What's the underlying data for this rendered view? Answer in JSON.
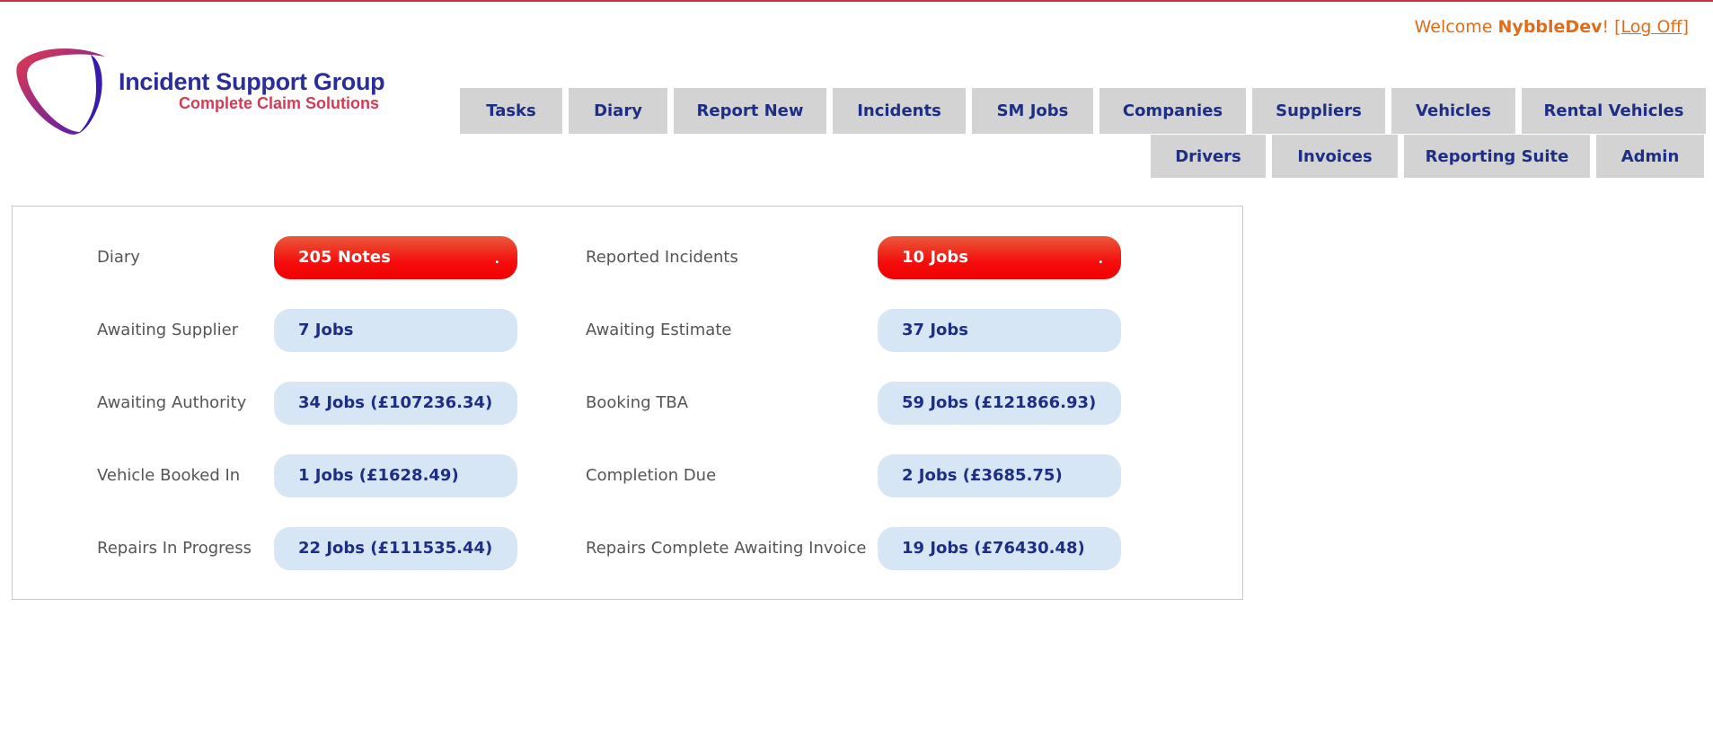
{
  "header": {
    "welcome_prefix": "Welcome ",
    "username": "NybbleDev",
    "welcome_suffix": "! [",
    "logoff_label": "Log Off",
    "logoff_close": "]"
  },
  "logo": {
    "title": "Incident Support Group",
    "subtitle": "Complete Claim Solutions"
  },
  "nav": {
    "row1": [
      {
        "label": "Tasks"
      },
      {
        "label": "Diary"
      },
      {
        "label": "Report New"
      },
      {
        "label": "Incidents"
      },
      {
        "label": "SM Jobs"
      },
      {
        "label": "Companies"
      },
      {
        "label": "Suppliers"
      },
      {
        "label": "Vehicles"
      },
      {
        "label": "Rental Vehicles"
      }
    ],
    "row2": [
      {
        "label": "Drivers"
      },
      {
        "label": "Invoices"
      },
      {
        "label": "Reporting Suite"
      },
      {
        "label": "Admin"
      }
    ]
  },
  "dashboard": {
    "rows": [
      {
        "left_label": "Diary",
        "left_value": "205 Notes",
        "left_style": "alert",
        "right_label": "Reported Incidents",
        "right_value": "10 Jobs",
        "right_style": "alert"
      },
      {
        "left_label": "Awaiting Supplier",
        "left_value": "7 Jobs",
        "left_style": "normal",
        "right_label": "Awaiting Estimate",
        "right_value": "37 Jobs",
        "right_style": "normal"
      },
      {
        "left_label": "Awaiting Authority",
        "left_value": "34 Jobs (£107236.34)",
        "left_style": "normal",
        "right_label": "Booking TBA",
        "right_value": "59 Jobs (£121866.93)",
        "right_style": "normal"
      },
      {
        "left_label": "Vehicle Booked In",
        "left_value": "1 Jobs (£1628.49)",
        "left_style": "normal",
        "right_label": "Completion Due",
        "right_value": "2 Jobs (£3685.75)",
        "right_style": "normal"
      },
      {
        "left_label": "Repairs In Progress",
        "left_value": "22 Jobs (£111535.44)",
        "left_style": "normal",
        "right_label": "Repairs Complete Awaiting Invoice",
        "right_value": "19 Jobs (£76430.48)",
        "right_style": "normal"
      }
    ]
  },
  "colors": {
    "accent": "#e06c1a",
    "nav_text": "#1c2f85",
    "nav_bg": "#d3d3d3",
    "pill_normal": "#d7e6f4",
    "pill_alert": "#f20000"
  }
}
